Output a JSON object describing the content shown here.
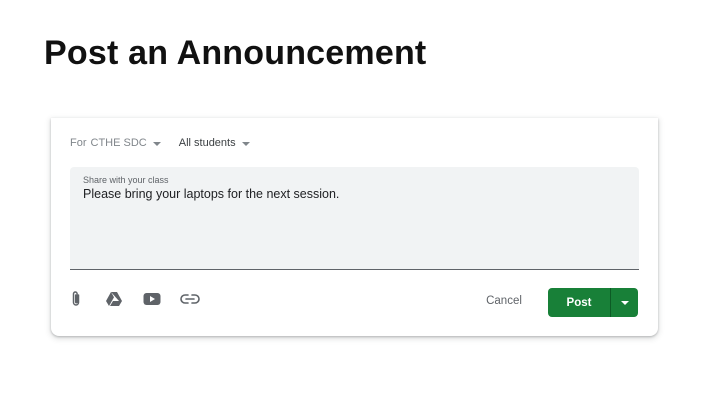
{
  "slide": {
    "title": "Post an Announcement"
  },
  "audience": {
    "for_label": "For",
    "class_value": "CTHE SDC",
    "students_value": "All students"
  },
  "composer": {
    "label": "Share with your class",
    "text": "Please bring your laptops for the next session."
  },
  "toolbar": {
    "icons": [
      "paperclip-icon",
      "google-drive-icon",
      "youtube-icon",
      "link-icon"
    ]
  },
  "actions": {
    "cancel_label": "Cancel",
    "post_label": "Post"
  },
  "colors": {
    "post_button": "#188038",
    "composer_bg": "#f1f3f4",
    "text_secondary": "#5f6368"
  }
}
